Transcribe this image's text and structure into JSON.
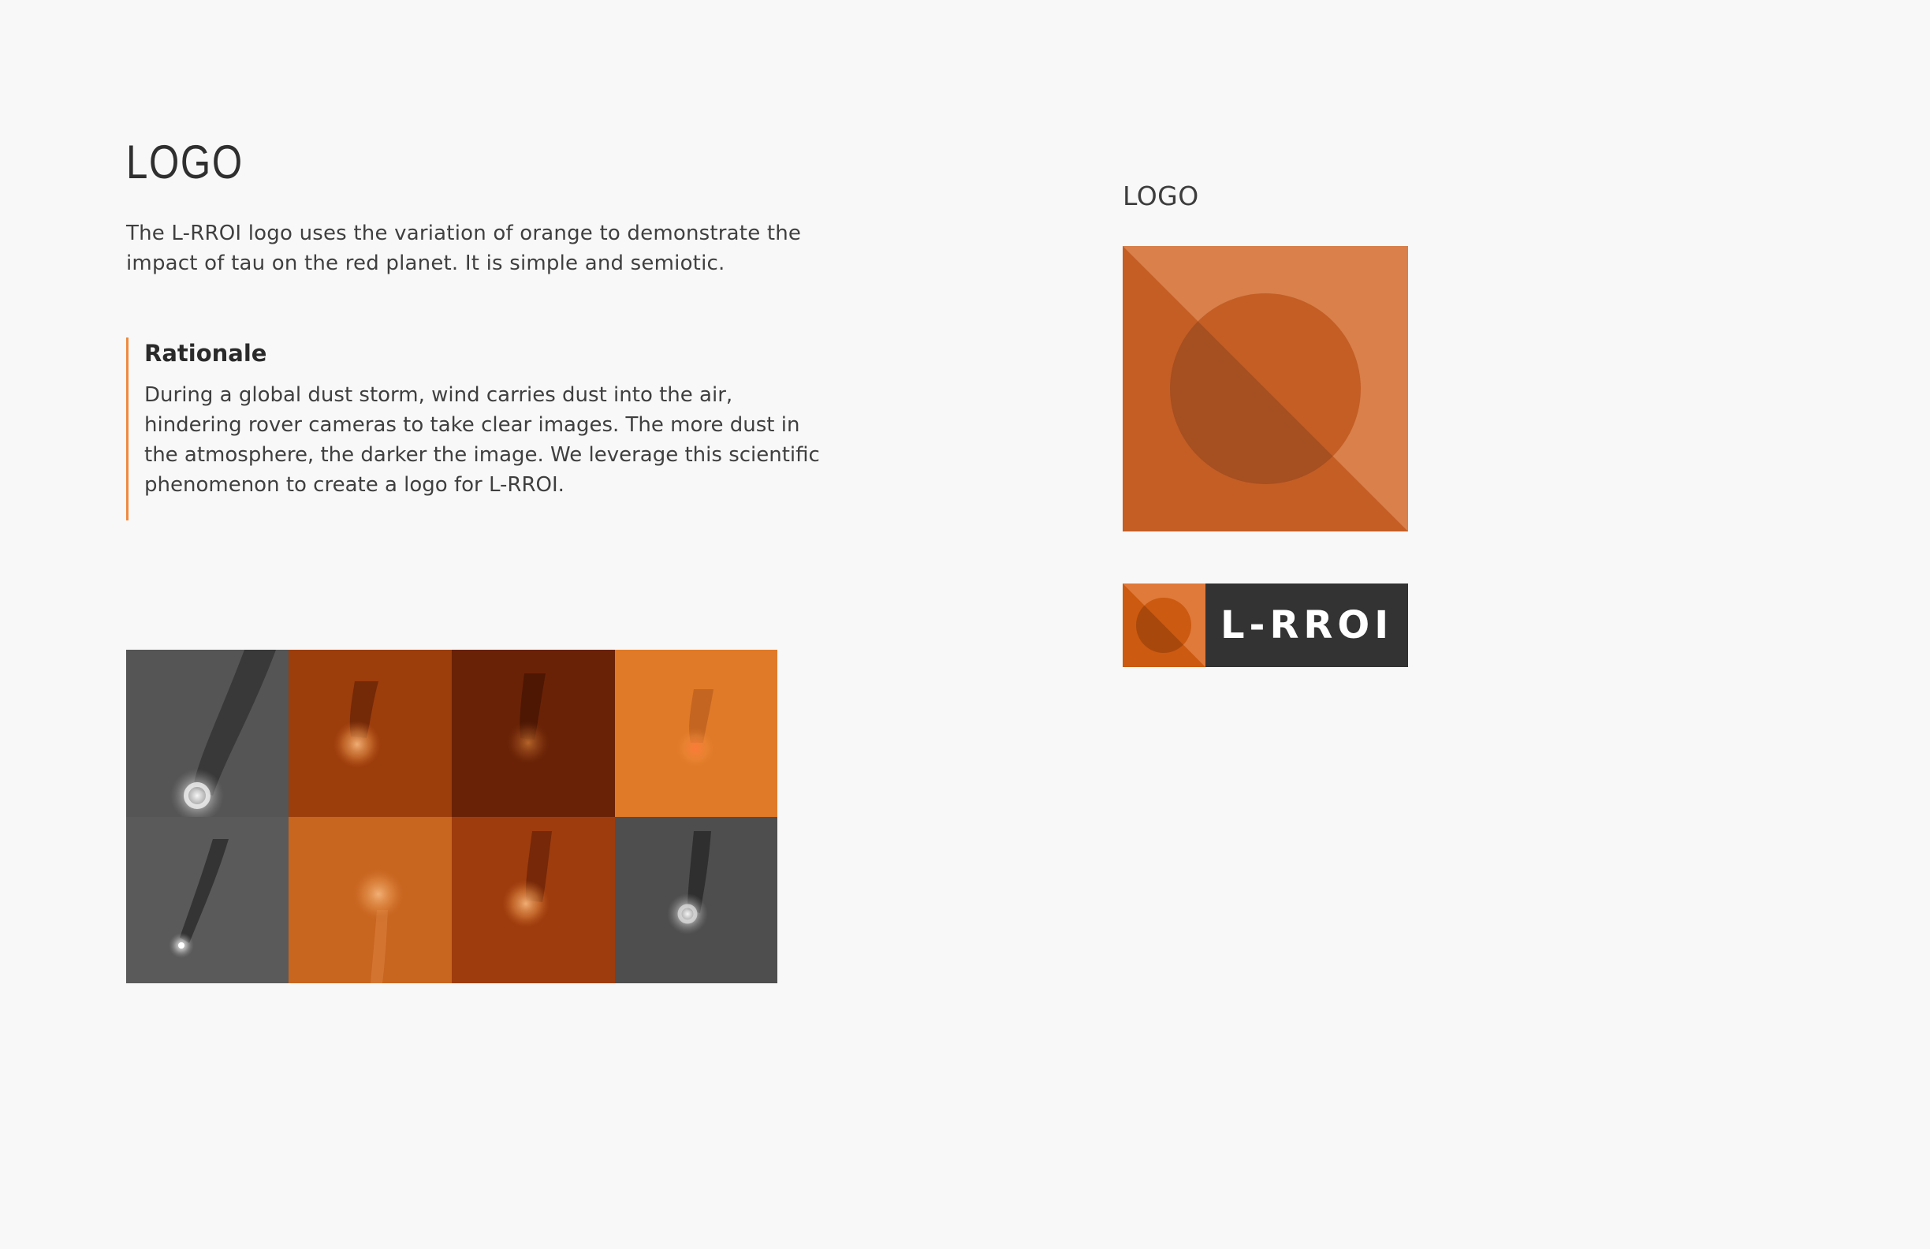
{
  "section": {
    "title": "LOGO",
    "intro": "The L-RROI logo uses the variation of orange to demonstrate the impact of tau on the red planet. It is simple and semiotic.",
    "rationale": {
      "title": "Rationale",
      "text": "During a global dust storm, wind carries dust into the air, hindering rover cameras to take clear images. The more dust in the atmosphere, the darker the image. We leverage this scientific phenomenon to create a logo for L-RROI."
    }
  },
  "logo_panel": {
    "label": "LOGO",
    "wordmark": "L-RROI"
  },
  "colors": {
    "accent_bar": "#ef8a3d",
    "logo_light": "#d9804b",
    "logo_mid": "#c45e25",
    "logo_dark": "#a64f20",
    "lockup_orange": "#cc5a10",
    "lockup_light": "#e07a3a",
    "lockup_bg": "#333333"
  },
  "photo_tiles": [
    {
      "row": 1,
      "tone": "grayscale"
    },
    {
      "row": 1,
      "tone": "orange-dark"
    },
    {
      "row": 1,
      "tone": "orange-darkest"
    },
    {
      "row": 1,
      "tone": "orange-bright"
    },
    {
      "row": 2,
      "tone": "grayscale"
    },
    {
      "row": 2,
      "tone": "orange"
    },
    {
      "row": 2,
      "tone": "orange-dark"
    },
    {
      "row": 2,
      "tone": "grayscale"
    }
  ]
}
